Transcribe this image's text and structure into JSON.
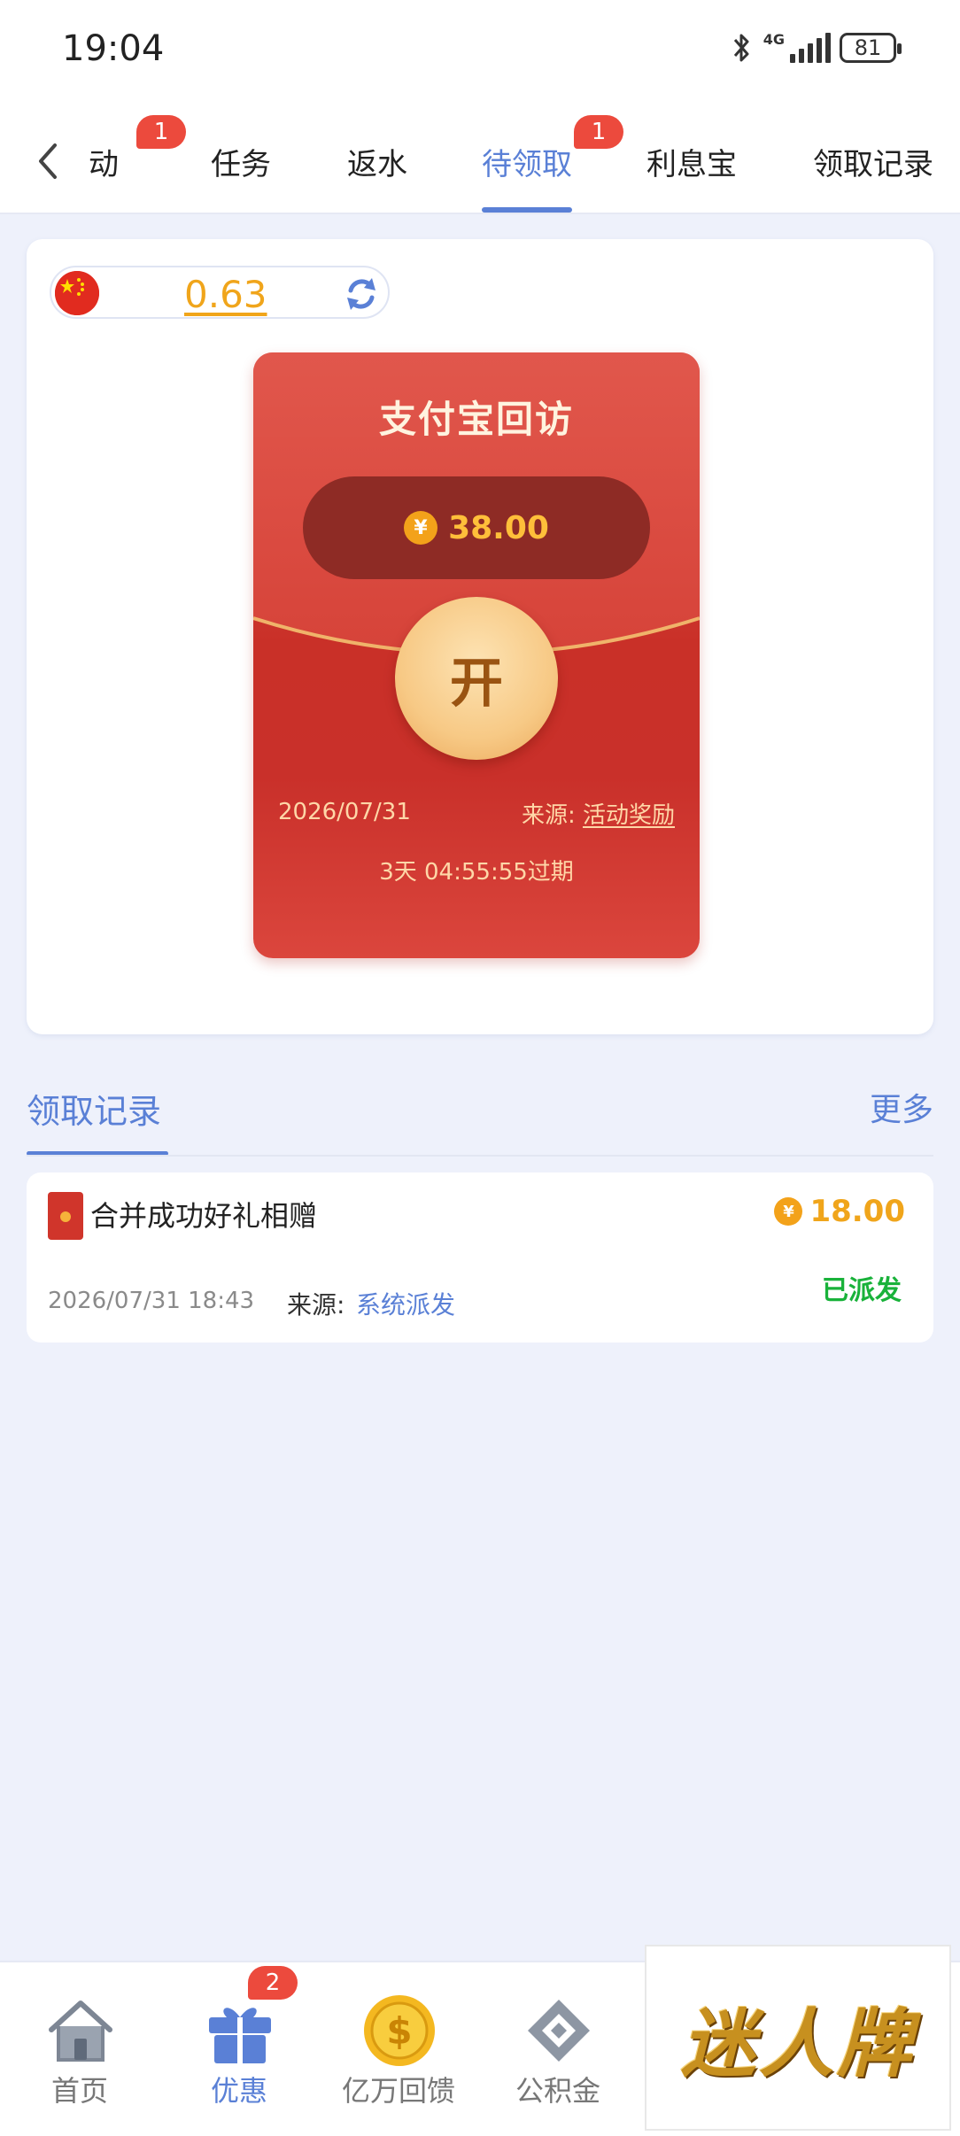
{
  "status_bar": {
    "time": "19:04",
    "network": "4G",
    "battery": "81"
  },
  "tabs": [
    {
      "label": "活动",
      "badge": "1"
    },
    {
      "label": "任务",
      "badge": ""
    },
    {
      "label": "返水",
      "badge": ""
    },
    {
      "label": "待领取",
      "badge": "1",
      "active": true
    },
    {
      "label": "利息宝",
      "badge": ""
    },
    {
      "label": "领取记录",
      "badge": ""
    }
  ],
  "balance": {
    "value": "0.63"
  },
  "envelope": {
    "title": "支付宝回访",
    "amount": "38.00",
    "currency_symbol": "¥",
    "open_label": "开",
    "date": "2026/07/31",
    "source_label": "来源:",
    "source_value": "活动奖励",
    "expire_text": "3天 04:55:55过期"
  },
  "records": {
    "title": "领取记录",
    "more_label": "更多",
    "items": [
      {
        "title": "合并成功好礼相赠",
        "amount": "18.00",
        "currency_symbol": "¥",
        "status": "已派发",
        "datetime": "2026/07/31 18:43",
        "source_label": "来源:",
        "source_value": "系统派发"
      }
    ]
  },
  "bottom_nav": [
    {
      "label": "首页",
      "icon": "home-icon"
    },
    {
      "label": "优惠",
      "icon": "gift-icon",
      "badge": "2",
      "active": true
    },
    {
      "label": "亿万回馈",
      "icon": "dollar-coin-icon"
    },
    {
      "label": "公积金",
      "icon": "fund-icon"
    }
  ],
  "brand": {
    "text": "迷人牌"
  },
  "colors": {
    "accent": "#5a80d6",
    "envelope_red": "#c9302a",
    "gold": "#f0a51b",
    "success": "#19b23a",
    "badge": "#ec4a3d"
  }
}
